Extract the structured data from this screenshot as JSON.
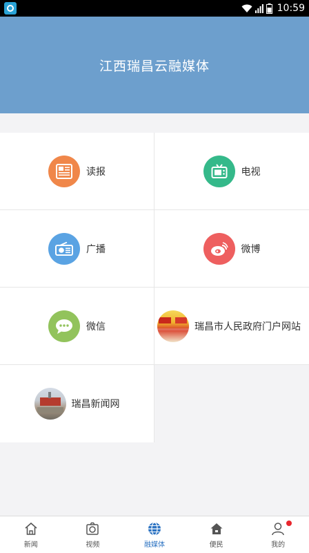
{
  "status_bar": {
    "time": "10:59"
  },
  "header": {
    "title": "江西瑞昌云融媒体"
  },
  "grid": {
    "items": [
      {
        "label": "读报",
        "color": "#f0874a",
        "icon": "newspaper-icon"
      },
      {
        "label": "电视",
        "color": "#35b98a",
        "icon": "tv-icon"
      },
      {
        "label": "广播",
        "color": "#5aa3e3",
        "icon": "radio-icon"
      },
      {
        "label": "微博",
        "color": "#ee5f5f",
        "icon": "weibo-icon"
      },
      {
        "label": "微信",
        "color": "#92c35c",
        "icon": "wechat-icon"
      },
      {
        "label": "瑞昌市人民政府门户网站",
        "icon": "government-site-logo"
      },
      {
        "label": "瑞昌新闻网",
        "icon": "news-site-logo"
      }
    ]
  },
  "tabbar": {
    "active": "融媒体",
    "tabs": [
      {
        "label": "新闻",
        "icon": "home-icon"
      },
      {
        "label": "视频",
        "icon": "camera-icon"
      },
      {
        "label": "融媒体",
        "icon": "globe-icon"
      },
      {
        "label": "便民",
        "icon": "house-service-icon"
      },
      {
        "label": "我的",
        "icon": "user-icon"
      }
    ]
  }
}
